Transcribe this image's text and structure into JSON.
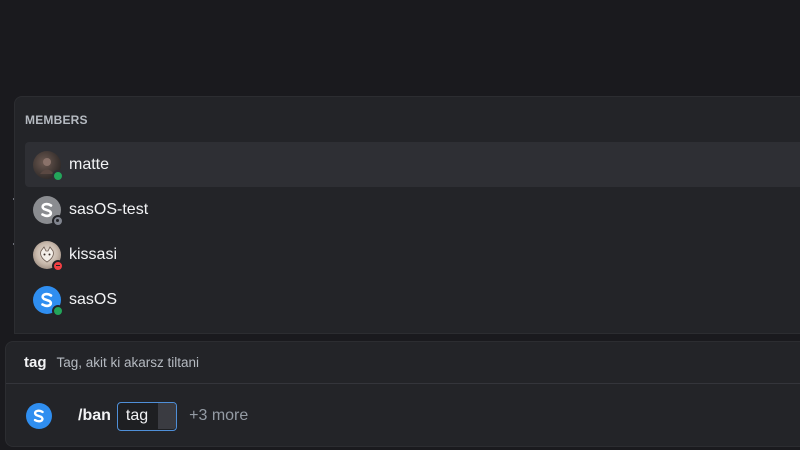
{
  "members_popup": {
    "header": "MEMBERS",
    "members": [
      {
        "name": "matte",
        "avatar": "matte-avatar",
        "status": "online",
        "selected": true
      },
      {
        "name": "sasOS-test",
        "avatar": "sasos-logo-avatar",
        "status": "offline",
        "selected": false
      },
      {
        "name": "kissasi",
        "avatar": "kissasi-avatar",
        "status": "dnd",
        "selected": false
      },
      {
        "name": "sasOS",
        "avatar": "sasos-logo-avatar",
        "status": "online",
        "selected": false
      }
    ]
  },
  "command_box": {
    "option_hint": {
      "name": "tag",
      "description": "Tag, akit ki akarsz tiltani"
    },
    "app_icon": "sasos-logo-icon",
    "command": "/ban",
    "active_option": "tag",
    "more": "+3 more"
  },
  "colors": {
    "background": "#1a1a1e",
    "popup": "#232428",
    "selected_row": "#2e2f34",
    "online": "#23a55a",
    "offline": "#80848e",
    "dnd": "#f23f43",
    "accent": "#2f8ef0",
    "focus_border": "#4f8fd8"
  }
}
